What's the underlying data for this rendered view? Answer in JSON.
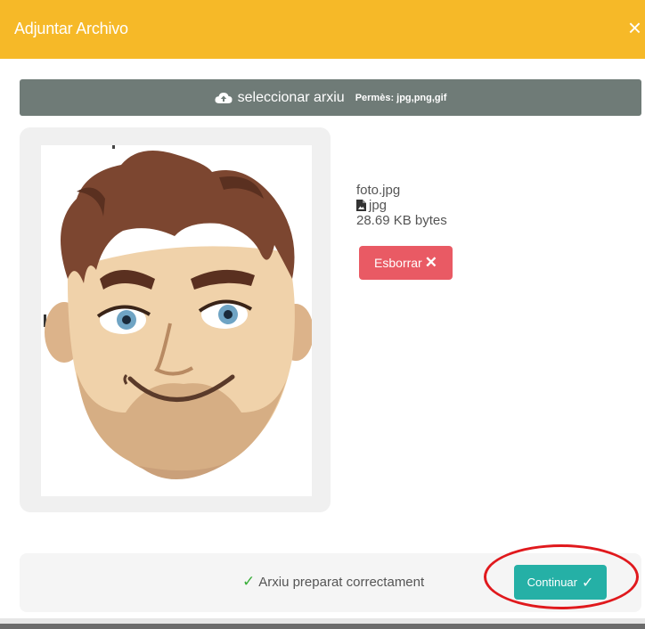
{
  "modal": {
    "title": "Adjuntar Archivo",
    "close_glyph": "×"
  },
  "upload": {
    "icon": "cloud-upload-icon",
    "label": "seleccionar arxiu",
    "allowed_formats": "Permès: jpg,png,gif"
  },
  "file": {
    "name": "foto.jpg",
    "type_icon": "file-image-icon",
    "type": "jpg",
    "size": "28.69 KB bytes",
    "preview_image": "cartoon-man-avatar",
    "delete_label": "Esborrar",
    "delete_glyph": "✕"
  },
  "footer": {
    "status_glyph": "✓",
    "status_text": "Arxiu preparat correctament",
    "continue_label": "Continuar",
    "continue_glyph": "✓"
  },
  "colors": {
    "header": "#f6b928",
    "upload_bar": "#6f7b77",
    "delete": "#e95a64",
    "continue": "#25b0a6",
    "success": "#3aae3a",
    "highlight": "#e0191d"
  }
}
